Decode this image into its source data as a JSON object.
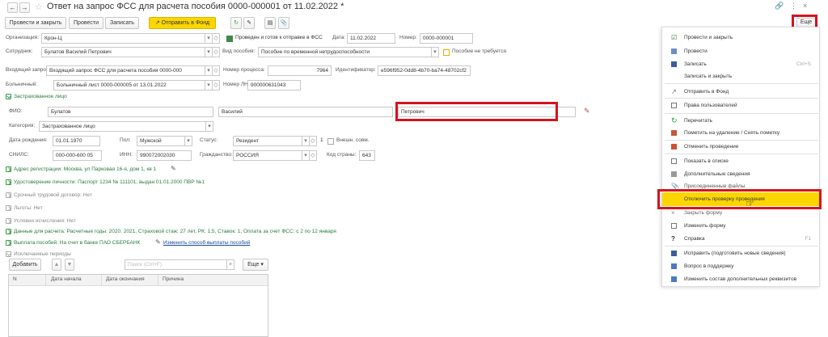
{
  "window": {
    "title": "Ответ на запрос ФСС для расчета пособия 0000-000001 от 11.02.2022 *",
    "back_icon": "arrow-left-icon",
    "forward_icon": "arrow-right-icon",
    "star_icon": "star-icon"
  },
  "toolbar": {
    "post_close": "Провести и закрыть",
    "post": "Провести",
    "save": "Записать",
    "send_fund": "Отправить в Фонд",
    "more": "Еще"
  },
  "header": {
    "org_label": "Организация:",
    "org_value": "Крон-Ц",
    "status_text": "Проведен и готов к отправке в ФСС",
    "date_label": "Дата:",
    "date_value": "11.02.2022",
    "number_label": "Номер:",
    "number_value": "0000-000001",
    "employee_label": "Сотрудник:",
    "employee_value": "Булатов Василий Петрович",
    "benefit_type_label": "Вид пособия:",
    "benefit_type_value": "Пособие по временной нетрудоспособности",
    "no_benefit_label": "Пособие не требуется",
    "request_label": "Входящий запрос:",
    "request_value": "Входящий запрос ФСС для расчета пособия 0000-000",
    "process_num_label": "Номер процесса:",
    "process_num_value": "7964",
    "identifier_label": "Идентификатор:",
    "identifier_value": "e596f952-0dd8-4b70-ba74-48702cf2",
    "sick_list_label": "Больничный:",
    "sick_list_value": "Больничный лист 0000-000005 от 13.01.2022",
    "ln_num_label": "Номер ЛН:",
    "ln_num_value": "900000631043"
  },
  "insured": {
    "section_label": "Застрахованное лицо",
    "fio_label": "ФИО:",
    "last_name": "Булатов",
    "first_name": "Василий",
    "middle_name": "Петрович",
    "category_label": "Категория:",
    "category_value": "Застрахованное лицо",
    "birth_label": "Дата рождения:",
    "birth_value": "01.01.1970",
    "sex_label": "Пол:",
    "sex_value": "Мужской",
    "status_label": "Статус:",
    "status_value": "Резидент",
    "status_num": "1",
    "foreign_label": "Внешн. совм.",
    "snils_label": "СНИЛС:",
    "snils_value": "000-000-600 05",
    "inn_label": "ИНН:",
    "inn_value": "990072002030",
    "citizenship_label": "Гражданство:",
    "citizenship_value": "РОССИЯ",
    "country_code_label": "Код страны:",
    "country_code_value": "643"
  },
  "sections": [
    "Адрес регистрации: Москва, ул Парковая 16-я, дом 1, кв 1",
    "Удостоверение личности: Паспорт 1234 № 111101, выдан 01.01.2000 ПВР №1",
    "Срочный трудовой договор: Нет",
    "Льготы: Нет",
    "Условия исчисления: Нет",
    "Данные для расчета: Расчетные годы: 2020, 2021, Страховой стаж: 27 лет, РК: 1,5, Ставок: 1, Оплата за счет ФСС: с 2 по 12 января",
    "Выплата пособий: На счет в банке ПАО СБЕРБАНК",
    "Исключаемые периоды"
  ],
  "payment_link": "Изменить способ выплаты пособий",
  "table": {
    "add": "Добавить",
    "search_placeholder": "Поиск (Ctrl+F)",
    "more": "Еще",
    "columns": [
      "N",
      "Дата начала",
      "Дата окончания",
      "Причина"
    ]
  },
  "menu": {
    "items": [
      {
        "label": "Провести и закрыть",
        "shortcut": ""
      },
      {
        "label": "Провести",
        "shortcut": ""
      },
      {
        "label": "Записать",
        "shortcut": "Ctrl+S"
      },
      {
        "label": "Записать и закрыть",
        "shortcut": ""
      },
      {
        "label": "Отправить в Фонд",
        "shortcut": ""
      },
      {
        "label": "Права пользователей",
        "shortcut": ""
      },
      {
        "label": "Перечитать",
        "shortcut": ""
      },
      {
        "label": "Пометить на удаление / Снять пометку",
        "shortcut": ""
      },
      {
        "label": "Отменить проведение",
        "shortcut": ""
      },
      {
        "label": "Показать в списке",
        "shortcut": ""
      },
      {
        "label": "Дополнительные сведения",
        "shortcut": ""
      },
      {
        "label": "Присоединенные файлы",
        "shortcut": ""
      },
      {
        "label": "Отключить проверку проведения",
        "shortcut": ""
      },
      {
        "label": "Закрыть форму",
        "shortcut": ""
      },
      {
        "label": "Изменить форму",
        "shortcut": ""
      },
      {
        "label": "Справка",
        "shortcut": "F1"
      },
      {
        "label": "Исправить (подготовить новые сведения)",
        "shortcut": ""
      },
      {
        "label": "Вопрос в поддержку",
        "shortcut": ""
      },
      {
        "label": "Изменить состав дополнительных реквизитов",
        "shortcut": ""
      }
    ]
  },
  "colors": {
    "accent_yellow": "#fbd600",
    "highlight_red": "#d3141f",
    "link_green": "#2a7b3c"
  }
}
